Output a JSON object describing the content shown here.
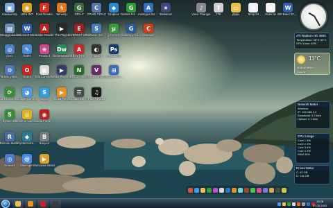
{
  "desktop": {
    "icons": [
      {
        "label": "Компьютер",
        "col": 0,
        "row": 0,
        "color": "#7fa9d8",
        "glyph": "▣"
      },
      {
        "label": "Ultra ISO",
        "col": 1,
        "row": 0,
        "color": "#e0a020",
        "glyph": "◉"
      },
      {
        "label": "Foxit Reader",
        "col": 2,
        "row": 0,
        "color": "#d83020",
        "glyph": "F"
      },
      {
        "label": "Winamp",
        "col": 3,
        "row": 0,
        "color": "#e07a20",
        "glyph": "ϟ"
      },
      {
        "label": "GPU-Z",
        "col": 4,
        "row": 0,
        "color": "#3a6a3a",
        "glyph": "G"
      },
      {
        "label": "CPUID CPU-Z",
        "col": 5,
        "row": 0,
        "color": "#5577aa",
        "glyph": "C"
      },
      {
        "label": "Dropbox",
        "col": 6,
        "row": 0,
        "color": "#2a88d8",
        "glyph": "◆"
      },
      {
        "label": "Games For Windows",
        "col": 7,
        "row": 0,
        "color": "#2a9a3a",
        "glyph": "G"
      },
      {
        "label": "Auslogics BoostSpeed",
        "col": 8,
        "row": 0,
        "color": "#3070c0",
        "glyph": "A"
      },
      {
        "label": "Stellarium",
        "col": 9,
        "row": 0,
        "color": "#3a4a7a",
        "glyph": "★"
      },
      {
        "label": "Voice Changer",
        "col": 11,
        "row": 0,
        "color": "#8a8a8a",
        "glyph": "♪"
      },
      {
        "label": "TTK",
        "col": 12,
        "row": 0,
        "color": "#cfcfcf",
        "glyph": "T"
      },
      {
        "label": "Деды",
        "col": 13,
        "row": 0,
        "color": "#e8c24a",
        "glyph": "▭"
      },
      {
        "label": "Temp.txt",
        "col": 14,
        "row": 0,
        "color": "#f0f0f0",
        "glyph": "≡"
      },
      {
        "label": "Hubs.txt",
        "col": 15,
        "row": 0,
        "color": "#f0f0f0",
        "glyph": "≡"
      },
      {
        "label": "Gift-Band 2010.doc",
        "col": 16,
        "row": 0,
        "color": "#3060b0",
        "glyph": "W"
      },
      {
        "label": "Оборудование",
        "col": 0,
        "row": 1,
        "color": "#6f8fb8",
        "glyph": "▤"
      },
      {
        "label": "Microsoft Word",
        "col": 1,
        "row": 1,
        "color": "#2a5aa8",
        "glyph": "W"
      },
      {
        "label": "Adobe Reader",
        "col": 2,
        "row": 1,
        "color": "#c02020",
        "glyph": "A"
      },
      {
        "label": "The Player",
        "col": 3,
        "row": 1,
        "color": "#2a2a2a",
        "glyph": "▶"
      },
      {
        "label": "EVEREST Ultimate",
        "col": 4,
        "row": 1,
        "color": "#a02020",
        "glyph": "E"
      },
      {
        "label": "Software Service",
        "col": 5,
        "row": 1,
        "color": "#4a7ab8",
        "glyph": "S"
      },
      {
        "label": "µTorrent",
        "col": 6,
        "row": 1,
        "color": "#3a9a3a",
        "glyph": "µ"
      },
      {
        "label": "GameSpy Comrade",
        "col": 7,
        "row": 1,
        "color": "#2a5a9a",
        "glyph": "G"
      },
      {
        "label": "CCleaner",
        "col": 8,
        "row": 1,
        "color": "#c84020",
        "glyph": "C"
      },
      {
        "label": "Сеть",
        "col": 0,
        "row": 2,
        "color": "#4a80c8",
        "glyph": "◎"
      },
      {
        "label": "Notes",
        "col": 1,
        "row": 2,
        "color": "#4a8ad8",
        "glyph": "✎"
      },
      {
        "label": "Picasa 3",
        "col": 2,
        "row": 2,
        "color": "#d04a8a",
        "glyph": "❀"
      },
      {
        "label": "Dreamweaver",
        "col": 3,
        "row": 2,
        "color": "#2a8a5a",
        "glyph": "Dw"
      },
      {
        "label": "ABBYY FineReader",
        "col": 4,
        "row": 2,
        "color": "#c02a2a",
        "glyph": "A"
      },
      {
        "label": "ImgBurn",
        "col": 5,
        "row": 2,
        "color": "#333333",
        "glyph": "◐"
      },
      {
        "label": "Photoshop",
        "col": 6,
        "row": 2,
        "color": "#1a3a6a",
        "glyph": "Ps"
      },
      {
        "label": "Панель управления",
        "col": 0,
        "row": 3,
        "color": "#4a7ab8",
        "glyph": "⚙"
      },
      {
        "label": "Opera",
        "col": 1,
        "row": 3,
        "color": "#d02020",
        "glyph": "O"
      },
      {
        "label": "Total Commander",
        "col": 2,
        "row": 3,
        "color": "#d8d8d8",
        "glyph": "▦"
      },
      {
        "label": "Media Player Classic",
        "col": 3,
        "row": 3,
        "color": "#3a3a6a",
        "glyph": "▶"
      },
      {
        "label": "NOD32 Antivirus",
        "col": 4,
        "row": 3,
        "color": "#2a6a2a",
        "glyph": "N"
      },
      {
        "label": "VSO Downloader",
        "col": 5,
        "row": 3,
        "color": "#6a2a6a",
        "glyph": "V"
      },
      {
        "label": "Windows 8.0 Start Panel",
        "col": 6,
        "row": 3,
        "color": "#3a6ab8",
        "glyph": "⊞"
      },
      {
        "label": "Центр обновления",
        "col": 0,
        "row": 4,
        "color": "#3a8a3a",
        "glyph": "⟳"
      },
      {
        "label": "Google Chrome",
        "col": 1,
        "row": 4,
        "color": "#4a9ae8",
        "glyph": "◕"
      },
      {
        "label": "Skype",
        "col": 2,
        "row": 4,
        "color": "#2aa0e8",
        "glyph": "S"
      },
      {
        "label": "Media Player",
        "col": 3,
        "row": 4,
        "color": "#e89020",
        "glyph": "▶"
      },
      {
        "label": "Сервисный центр",
        "col": 4,
        "row": 4,
        "color": "#4a4a4a",
        "glyph": "☰"
      },
      {
        "label": "Play X Radio",
        "col": 5,
        "row": 4,
        "color": "#1a1a1a",
        "glyph": "♫"
      },
      {
        "label": "System.INI",
        "col": 0,
        "row": 5,
        "color": "#3a8a3a",
        "glyph": "S"
      },
      {
        "label": "Internet Video Conv",
        "col": 1,
        "row": 5,
        "color": "#e0b020",
        "glyph": "◎"
      },
      {
        "label": "Sound Forge Pro",
        "col": 2,
        "row": 5,
        "color": "#c02020",
        "glyph": "◉"
      },
      {
        "label": "Remote Master",
        "col": 0,
        "row": 6,
        "color": "#4a6aa8",
        "glyph": "R"
      },
      {
        "label": "Crystal Extractor",
        "col": 1,
        "row": 6,
        "color": "#2a7a9a",
        "glyph": "◆"
      },
      {
        "label": "Bonjour",
        "col": 2,
        "row": 6,
        "color": "#7a7a7a",
        "glyph": "B"
      },
      {
        "label": "Network",
        "col": 0,
        "row": 7,
        "color": "#4a7ac8",
        "glyph": "◎"
      },
      {
        "label": "Mail Agent",
        "col": 1,
        "row": 7,
        "color": "#4a8ae8",
        "glyph": "@"
      },
      {
        "label": "Windows Media",
        "col": 2,
        "row": 7,
        "color": "#e0a030",
        "glyph": "▶"
      }
    ]
  },
  "gadgets": {
    "gpu": {
      "title": "ATI Radeon HD 4850",
      "lines": [
        "Temperature: 46°C 53°C",
        "GPU Load: 12%"
      ]
    },
    "weather": {
      "temp": "11°C",
      "city": "Gidrometeo...",
      "detail": "Cloudy"
    },
    "network": {
      "title": "Network Meter",
      "lines": [
        "Wireless",
        "IP: 192.168.1.3",
        "Download: 0.2 kb/s",
        "Upload: 0.1 kb/s"
      ]
    },
    "cpu": {
      "title": "CPU Usage",
      "lines": [
        "Core 1  9%",
        "Core 2  4%",
        "Core 3  6%",
        "Core 4  3%",
        "RAM  46%"
      ]
    },
    "drives": {
      "title": "Drives Meter",
      "lines": [
        "C:  62 GB",
        "D:  118 GB"
      ]
    }
  },
  "taskbar": {
    "pinned": [
      {
        "name": "explorer",
        "color": "#e8c24a"
      },
      {
        "name": "media-player",
        "color": "#e89020"
      },
      {
        "name": "opera",
        "color": "#d02020"
      },
      {
        "name": "winamp",
        "color": "#3a3a3a"
      }
    ],
    "tray": [
      "#4a9ae8",
      "#e8c24a",
      "#3aa03a",
      "#d8d8d8",
      "#e86a20",
      "#9aa0a8",
      "#2a78c8",
      "#d02020"
    ],
    "clock_time": "19:26",
    "clock_date": "27.05.2010"
  },
  "dock_colors": [
    "#e05040",
    "#4a9ae8",
    "#e8c24a",
    "#3aa03a",
    "#c84ad8",
    "#d8d8d8",
    "#2a78c8",
    "#e89020",
    "#6ad8d8",
    "#9a4a2a",
    "#4ac84a",
    "#e84a9a",
    "#7a7ad8",
    "#d8a84a",
    "#4a4a4a",
    "#c8c84a"
  ]
}
